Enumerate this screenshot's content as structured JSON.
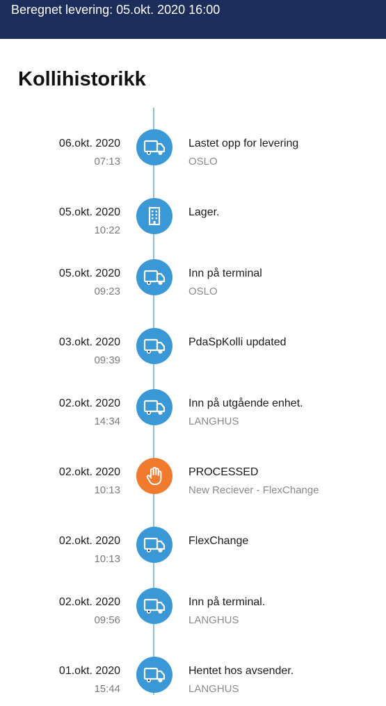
{
  "header": {
    "delivery_text": "Beregnet levering: 05.okt. 2020 16:00"
  },
  "page": {
    "title": "Kollihistorikk"
  },
  "colors": {
    "header_bg": "#1c2d5b",
    "timeline_blue": "#3a98d6",
    "timeline_orange": "#f07a2d",
    "timeline_line": "#8cbde3"
  },
  "events": [
    {
      "date": "06.okt. 2020",
      "time": "07:13",
      "title": "Lastet opp for levering",
      "location": "OSLO",
      "icon": "truck-icon"
    },
    {
      "date": "05.okt. 2020",
      "time": "10:22",
      "title": "Lager.",
      "location": "",
      "icon": "building-icon"
    },
    {
      "date": "05.okt. 2020",
      "time": "09:23",
      "title": "Inn på terminal",
      "location": "OSLO",
      "icon": "truck-icon"
    },
    {
      "date": "03.okt. 2020",
      "time": "09:39",
      "title": "PdaSpKolli updated",
      "location": "",
      "icon": "truck-icon"
    },
    {
      "date": "02.okt. 2020",
      "time": "14:34",
      "title": "Inn på utgående enhet.",
      "location": "LANGHUS",
      "icon": "truck-icon"
    },
    {
      "date": "02.okt. 2020",
      "time": "10:13",
      "title": "PROCESSED",
      "location": "New Reciever - FlexChange",
      "icon": "hand-icon"
    },
    {
      "date": "02.okt. 2020",
      "time": "10:13",
      "title": "FlexChange",
      "location": "",
      "icon": "truck-icon"
    },
    {
      "date": "02.okt. 2020",
      "time": "09:56",
      "title": "Inn på terminal.",
      "location": "LANGHUS",
      "icon": "truck-icon"
    },
    {
      "date": "01.okt. 2020",
      "time": "15:44",
      "title": "Hentet hos avsender.",
      "location": "LANGHUS",
      "icon": "truck-icon"
    }
  ]
}
